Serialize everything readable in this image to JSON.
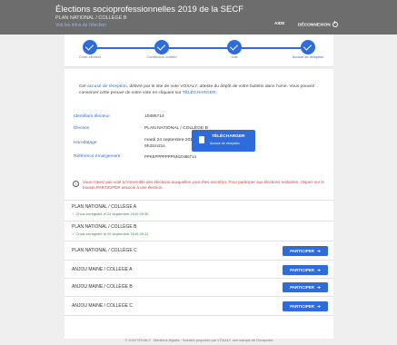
{
  "header": {
    "title": "Élections socioprofessionnelles 2019 de la SECF",
    "college": "PLAN NATIONAL / COLLÈGE B",
    "sublink": "Voir les infos de l'élection",
    "help": "AIDE",
    "logout": "DÉCONNEXION"
  },
  "steps": [
    {
      "label": "Choix électeur"
    },
    {
      "label": "Constitution bulletin"
    },
    {
      "label": "Vote"
    },
    {
      "label": "Accusé de réception"
    }
  ],
  "intro": {
    "pre": "Cet ",
    "link": "accusé de réception",
    "mid": ", délivré par le site de vote VOXALY, atteste du dépôt de votre bulletin dans l'urne. Vous pouvez conserver cette preuve de votre vote en cliquant sur ",
    "cta": "TÉLÉCHARGER",
    "end": "."
  },
  "info": {
    "id_label": "Identifiant électeur",
    "id_value": "10486714",
    "election_label": "Élection",
    "election_value": "PLAN NATIONAL / COLLÈGE B",
    "timestamp_label": "Horodatage",
    "timestamp_line1": "mardi 24 septembre 2019 à",
    "timestamp_line2": "9h31m21s",
    "ref_label": "Référence émargement",
    "ref_value": "PPKEPPPPPPPNN10486714"
  },
  "download": {
    "title": "TÉLÉCHARGER",
    "subtitle": "Accusé de réception"
  },
  "warning": "Vous n'avez pas voté à l'ensemble des élections auxquelles vous êtes inscrit(e). Pour participer aux élections restantes, cliquez sur le bouton PARTICIPER associé à une élection.",
  "elections": [
    {
      "title": "PLAN NATIONAL / COLLÈGE A",
      "note": "✓ Choix enregistré le 24 septembre 2019 09:30"
    },
    {
      "title": "PLAN NATIONAL / COLLÈGE B",
      "note": "✓ Choix enregistré le 24 septembre 2019 09:31"
    },
    {
      "title": "PLAN NATIONAL / COLLÈGE C",
      "button": "PARTICIPER"
    },
    {
      "title": "ANJOU MAINE / COLLÈGE A",
      "button": "PARTICIPER"
    },
    {
      "title": "ANJOU MAINE / COLLÈGE B",
      "button": "PARTICIPER"
    },
    {
      "title": "ANJOU MAINE / COLLÈGE C",
      "button": "PARTICIPER"
    }
  ],
  "footer": "© 2019 VOXALY · Mentions légales · Solution proposée par VOXALY, une marque de Docaposte",
  "colors": {
    "accent": "#2f6cdb",
    "header": "#6d6d6d",
    "warning": "#d23f3f",
    "success": "#3a8a4a"
  }
}
